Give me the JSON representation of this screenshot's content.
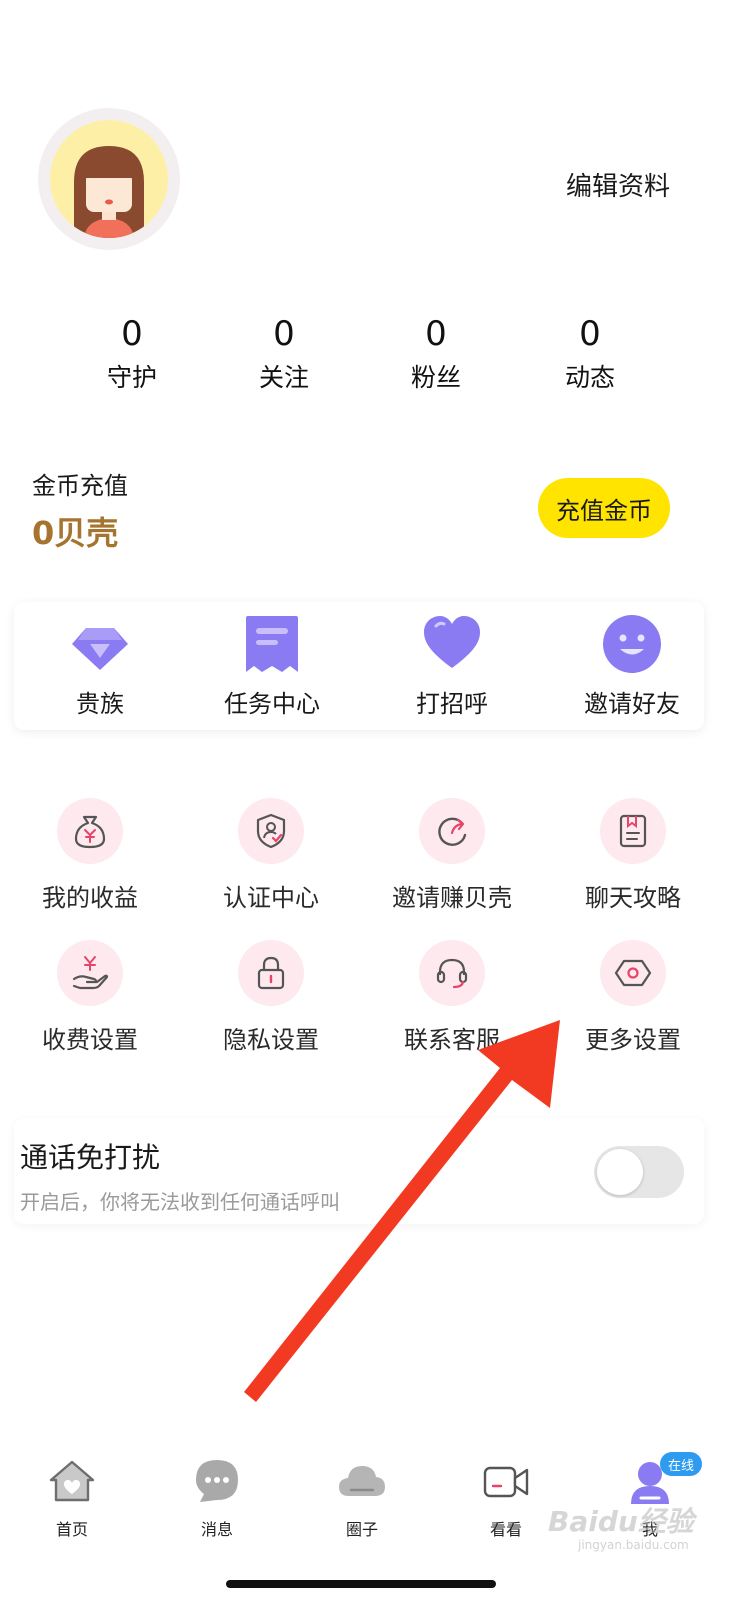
{
  "profile": {
    "edit_label": "编辑资料"
  },
  "stats": [
    {
      "value": "0",
      "label": "守护"
    },
    {
      "value": "0",
      "label": "关注"
    },
    {
      "value": "0",
      "label": "粉丝"
    },
    {
      "value": "0",
      "label": "动态"
    }
  ],
  "coins": {
    "title": "金币充值",
    "balance": "0贝壳",
    "recharge_label": "充值金币"
  },
  "features": [
    {
      "label": "贵族",
      "icon": "diamond-icon"
    },
    {
      "label": "任务中心",
      "icon": "receipt-icon"
    },
    {
      "label": "打招呼",
      "icon": "heart-icon"
    },
    {
      "label": "邀请好友",
      "icon": "smile-icon"
    }
  ],
  "grid": [
    {
      "label": "我的收益",
      "icon": "money-bag-icon"
    },
    {
      "label": "认证中心",
      "icon": "shield-user-icon"
    },
    {
      "label": "邀请赚贝壳",
      "icon": "share-arrow-icon"
    },
    {
      "label": "聊天攻略",
      "icon": "bookmark-doc-icon"
    },
    {
      "label": "收费设置",
      "icon": "yuan-hand-icon"
    },
    {
      "label": "隐私设置",
      "icon": "lock-icon"
    },
    {
      "label": "联系客服",
      "icon": "headset-icon"
    },
    {
      "label": "更多设置",
      "icon": "hexagon-settings-icon"
    }
  ],
  "dnd": {
    "title": "通话免打扰",
    "subtitle": "开启后，你将无法收到任何通话呼叫",
    "enabled": false
  },
  "tabs": [
    {
      "label": "首页",
      "icon": "home-icon"
    },
    {
      "label": "消息",
      "icon": "chat-bubble-icon"
    },
    {
      "label": "圈子",
      "icon": "cloud-icon"
    },
    {
      "label": "看看",
      "icon": "video-camera-icon"
    },
    {
      "label": "我",
      "icon": "user-icon"
    }
  ],
  "online_badge": "在线",
  "watermark": {
    "brand": "Baidu经验",
    "url": "jingyan.baidu.com"
  },
  "colors": {
    "accent_yellow": "#ffe400",
    "coin_brown": "#a6742e",
    "feature_purple": "#8b7bf2",
    "icon_pink_bg": "#fde9ee",
    "arrow_red": "#f23a22",
    "badge_blue": "#2d9bf0"
  }
}
